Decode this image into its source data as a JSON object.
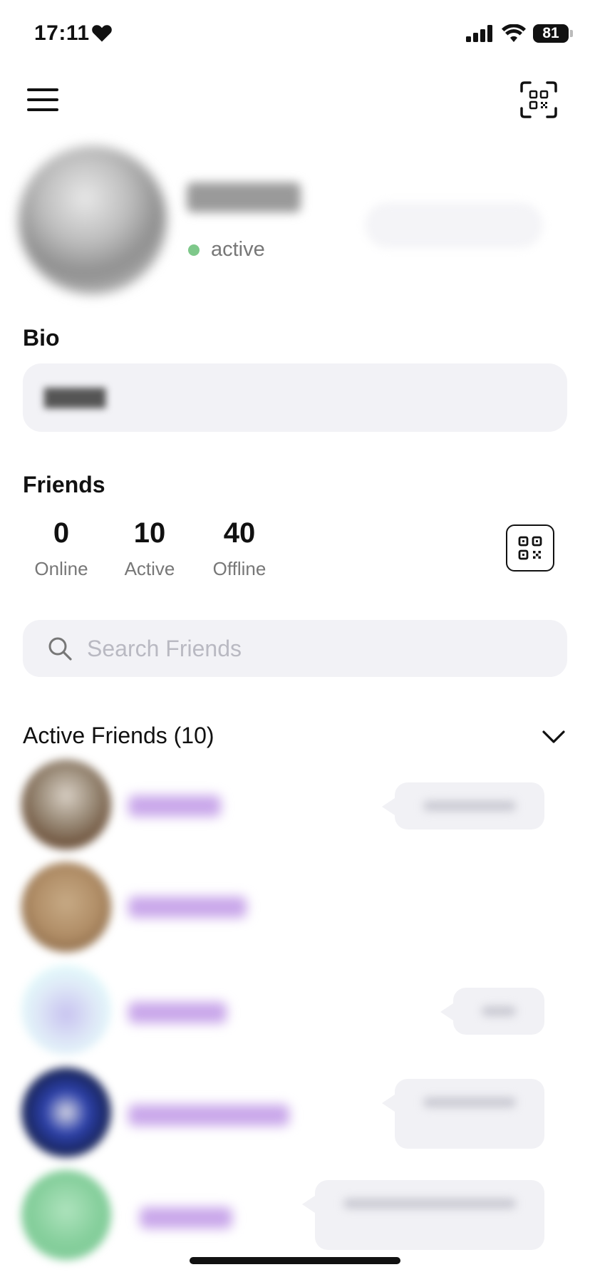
{
  "status_bar": {
    "time": "17:11",
    "battery": "81"
  },
  "profile": {
    "status": "active"
  },
  "bio": {
    "title": "Bio"
  },
  "friends": {
    "title": "Friends",
    "stats": [
      {
        "value": "0",
        "label": "Online"
      },
      {
        "value": "10",
        "label": "Active"
      },
      {
        "value": "40",
        "label": "Offline"
      }
    ]
  },
  "search": {
    "placeholder": "Search Friends",
    "value": ""
  },
  "active_friends": {
    "title": "Active Friends (10)",
    "expanded": true
  },
  "colors": {
    "status_active": "#7ec88a",
    "friend_name": "#c9a7ea",
    "surface": "#f2f2f6"
  }
}
